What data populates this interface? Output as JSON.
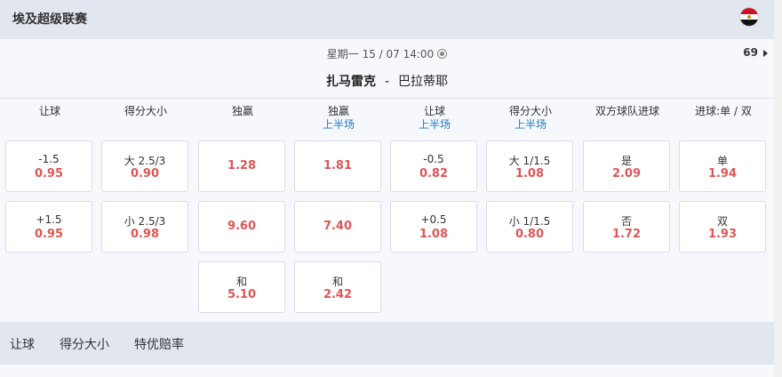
{
  "league": {
    "title": "埃及超级联赛",
    "flag_icon": "egypt-flag-icon"
  },
  "match": {
    "datetime": "星期一 15 / 07   14:00",
    "home_team": "扎马雷克",
    "separator": "-",
    "away_team": "巴拉蒂耶",
    "markets_count": "69"
  },
  "columns": [
    {
      "title": "让球",
      "sub": ""
    },
    {
      "title": "得分大小",
      "sub": ""
    },
    {
      "title": "独赢",
      "sub": ""
    },
    {
      "title": "独赢",
      "sub": "上半场"
    },
    {
      "title": "让球",
      "sub": "上半场"
    },
    {
      "title": "得分大小",
      "sub": "上半场"
    },
    {
      "title": "双方球队进球",
      "sub": ""
    },
    {
      "title": "进球:单 / 双",
      "sub": ""
    }
  ],
  "odds": [
    [
      {
        "label": "-1.5",
        "odd": "0.95"
      },
      {
        "label": "+1.5",
        "odd": "0.95"
      }
    ],
    [
      {
        "label": "大 2.5/3",
        "odd": "0.90"
      },
      {
        "label": "小 2.5/3",
        "odd": "0.98"
      }
    ],
    [
      {
        "label": "",
        "odd": "1.28"
      },
      {
        "label": "",
        "odd": "9.60"
      },
      {
        "label": "和",
        "odd": "5.10"
      }
    ],
    [
      {
        "label": "",
        "odd": "1.81"
      },
      {
        "label": "",
        "odd": "7.40"
      },
      {
        "label": "和",
        "odd": "2.42"
      }
    ],
    [
      {
        "label": "-0.5",
        "odd": "0.82"
      },
      {
        "label": "+0.5",
        "odd": "1.08"
      }
    ],
    [
      {
        "label": "大 1/1.5",
        "odd": "1.08"
      },
      {
        "label": "小 1/1.5",
        "odd": "0.80"
      }
    ],
    [
      {
        "label": "是",
        "odd": "2.09"
      },
      {
        "label": "否",
        "odd": "1.72"
      }
    ],
    [
      {
        "label": "单",
        "odd": "1.94"
      },
      {
        "label": "双",
        "odd": "1.93"
      }
    ]
  ],
  "tabs": [
    "让球",
    "得分大小",
    "特优赔率"
  ],
  "colors": {
    "odd_red": "#e05555",
    "sub_blue": "#1f7ac6",
    "header_bg": "#e1e6ef"
  }
}
